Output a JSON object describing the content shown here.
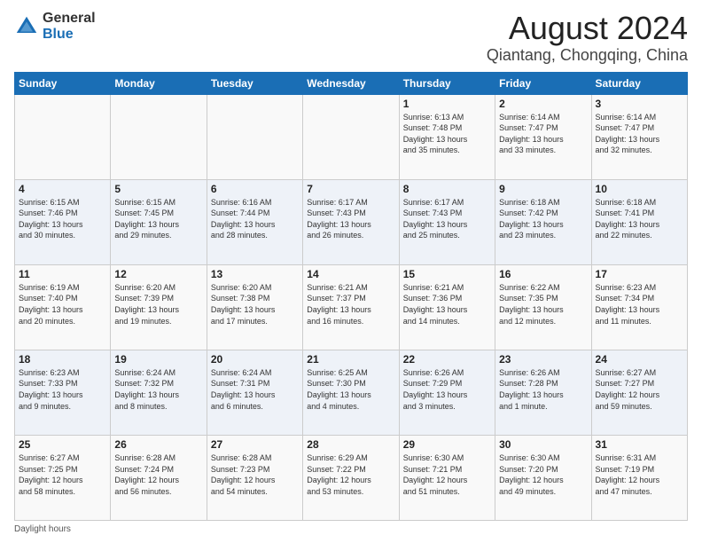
{
  "logo": {
    "general": "General",
    "blue": "Blue"
  },
  "header": {
    "title": "August 2024",
    "subtitle": "Qiantang, Chongqing, China"
  },
  "days_of_week": [
    "Sunday",
    "Monday",
    "Tuesday",
    "Wednesday",
    "Thursday",
    "Friday",
    "Saturday"
  ],
  "footer": {
    "label": "Daylight hours"
  },
  "weeks": [
    [
      {
        "day": "",
        "info": ""
      },
      {
        "day": "",
        "info": ""
      },
      {
        "day": "",
        "info": ""
      },
      {
        "day": "",
        "info": ""
      },
      {
        "day": "1",
        "info": "Sunrise: 6:13 AM\nSunset: 7:48 PM\nDaylight: 13 hours\nand 35 minutes."
      },
      {
        "day": "2",
        "info": "Sunrise: 6:14 AM\nSunset: 7:47 PM\nDaylight: 13 hours\nand 33 minutes."
      },
      {
        "day": "3",
        "info": "Sunrise: 6:14 AM\nSunset: 7:47 PM\nDaylight: 13 hours\nand 32 minutes."
      }
    ],
    [
      {
        "day": "4",
        "info": "Sunrise: 6:15 AM\nSunset: 7:46 PM\nDaylight: 13 hours\nand 30 minutes."
      },
      {
        "day": "5",
        "info": "Sunrise: 6:15 AM\nSunset: 7:45 PM\nDaylight: 13 hours\nand 29 minutes."
      },
      {
        "day": "6",
        "info": "Sunrise: 6:16 AM\nSunset: 7:44 PM\nDaylight: 13 hours\nand 28 minutes."
      },
      {
        "day": "7",
        "info": "Sunrise: 6:17 AM\nSunset: 7:43 PM\nDaylight: 13 hours\nand 26 minutes."
      },
      {
        "day": "8",
        "info": "Sunrise: 6:17 AM\nSunset: 7:43 PM\nDaylight: 13 hours\nand 25 minutes."
      },
      {
        "day": "9",
        "info": "Sunrise: 6:18 AM\nSunset: 7:42 PM\nDaylight: 13 hours\nand 23 minutes."
      },
      {
        "day": "10",
        "info": "Sunrise: 6:18 AM\nSunset: 7:41 PM\nDaylight: 13 hours\nand 22 minutes."
      }
    ],
    [
      {
        "day": "11",
        "info": "Sunrise: 6:19 AM\nSunset: 7:40 PM\nDaylight: 13 hours\nand 20 minutes."
      },
      {
        "day": "12",
        "info": "Sunrise: 6:20 AM\nSunset: 7:39 PM\nDaylight: 13 hours\nand 19 minutes."
      },
      {
        "day": "13",
        "info": "Sunrise: 6:20 AM\nSunset: 7:38 PM\nDaylight: 13 hours\nand 17 minutes."
      },
      {
        "day": "14",
        "info": "Sunrise: 6:21 AM\nSunset: 7:37 PM\nDaylight: 13 hours\nand 16 minutes."
      },
      {
        "day": "15",
        "info": "Sunrise: 6:21 AM\nSunset: 7:36 PM\nDaylight: 13 hours\nand 14 minutes."
      },
      {
        "day": "16",
        "info": "Sunrise: 6:22 AM\nSunset: 7:35 PM\nDaylight: 13 hours\nand 12 minutes."
      },
      {
        "day": "17",
        "info": "Sunrise: 6:23 AM\nSunset: 7:34 PM\nDaylight: 13 hours\nand 11 minutes."
      }
    ],
    [
      {
        "day": "18",
        "info": "Sunrise: 6:23 AM\nSunset: 7:33 PM\nDaylight: 13 hours\nand 9 minutes."
      },
      {
        "day": "19",
        "info": "Sunrise: 6:24 AM\nSunset: 7:32 PM\nDaylight: 13 hours\nand 8 minutes."
      },
      {
        "day": "20",
        "info": "Sunrise: 6:24 AM\nSunset: 7:31 PM\nDaylight: 13 hours\nand 6 minutes."
      },
      {
        "day": "21",
        "info": "Sunrise: 6:25 AM\nSunset: 7:30 PM\nDaylight: 13 hours\nand 4 minutes."
      },
      {
        "day": "22",
        "info": "Sunrise: 6:26 AM\nSunset: 7:29 PM\nDaylight: 13 hours\nand 3 minutes."
      },
      {
        "day": "23",
        "info": "Sunrise: 6:26 AM\nSunset: 7:28 PM\nDaylight: 13 hours\nand 1 minute."
      },
      {
        "day": "24",
        "info": "Sunrise: 6:27 AM\nSunset: 7:27 PM\nDaylight: 12 hours\nand 59 minutes."
      }
    ],
    [
      {
        "day": "25",
        "info": "Sunrise: 6:27 AM\nSunset: 7:25 PM\nDaylight: 12 hours\nand 58 minutes."
      },
      {
        "day": "26",
        "info": "Sunrise: 6:28 AM\nSunset: 7:24 PM\nDaylight: 12 hours\nand 56 minutes."
      },
      {
        "day": "27",
        "info": "Sunrise: 6:28 AM\nSunset: 7:23 PM\nDaylight: 12 hours\nand 54 minutes."
      },
      {
        "day": "28",
        "info": "Sunrise: 6:29 AM\nSunset: 7:22 PM\nDaylight: 12 hours\nand 53 minutes."
      },
      {
        "day": "29",
        "info": "Sunrise: 6:30 AM\nSunset: 7:21 PM\nDaylight: 12 hours\nand 51 minutes."
      },
      {
        "day": "30",
        "info": "Sunrise: 6:30 AM\nSunset: 7:20 PM\nDaylight: 12 hours\nand 49 minutes."
      },
      {
        "day": "31",
        "info": "Sunrise: 6:31 AM\nSunset: 7:19 PM\nDaylight: 12 hours\nand 47 minutes."
      }
    ]
  ]
}
